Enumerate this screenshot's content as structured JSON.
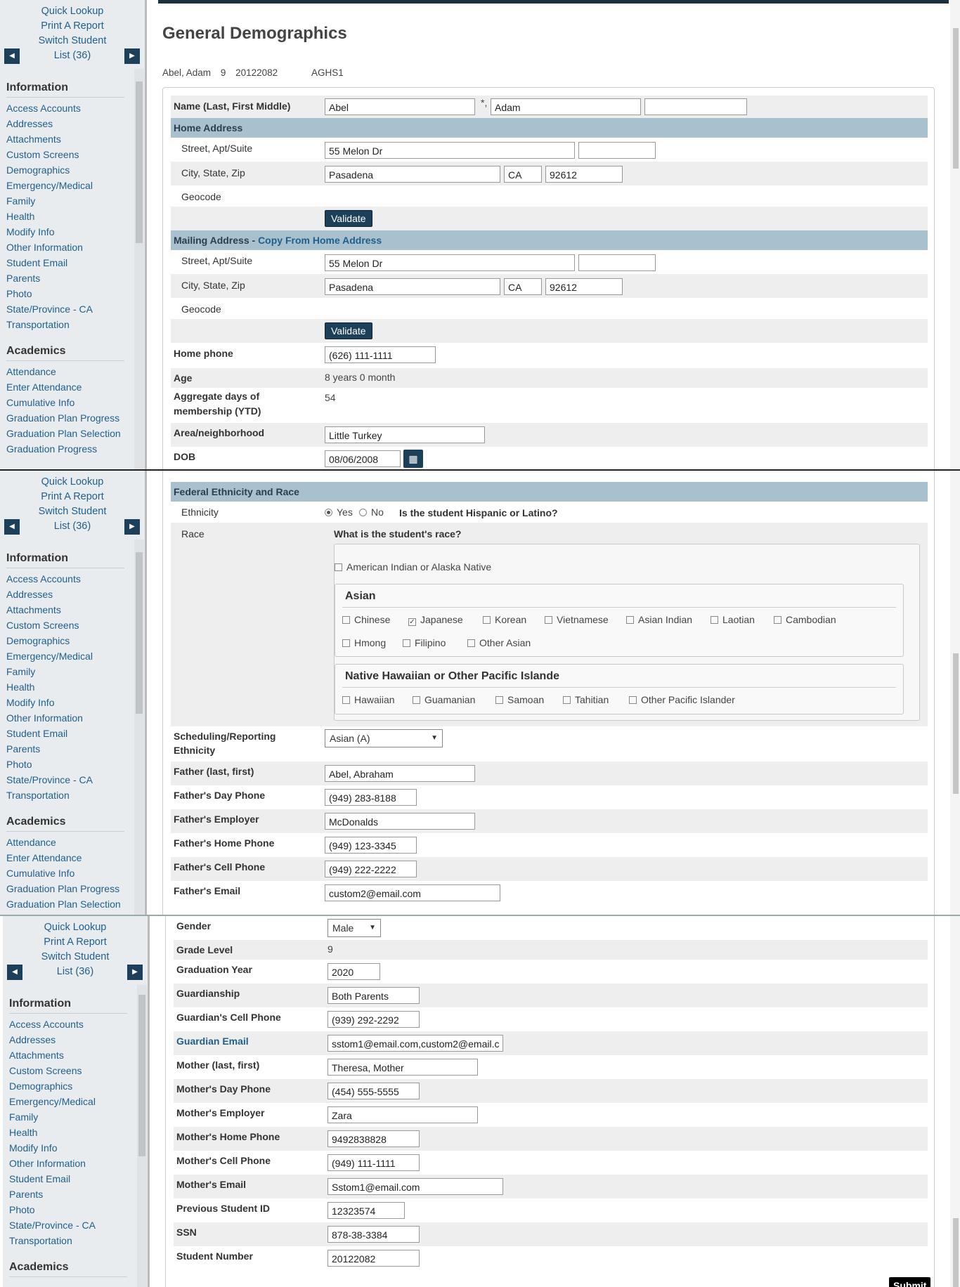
{
  "sidebar": {
    "quick_lookup": "Quick Lookup",
    "print_report": "Print A Report",
    "switch_student": "Switch Student",
    "list_label": "List (36)",
    "info_header": "Information",
    "info_items": [
      "Access Accounts",
      "Addresses",
      "Attachments",
      "Custom Screens",
      "Demographics",
      "Emergency/Medical",
      "Family",
      "Health",
      "Modify Info",
      "Other Information",
      "Student Email",
      "Parents",
      "Photo",
      "State/Province - CA",
      "Transportation"
    ],
    "acad_header": "Academics",
    "acad_items": [
      "Attendance",
      "Enter Attendance",
      "Cumulative Info",
      "Graduation Plan Progress",
      "Graduation Plan Selection",
      "Graduation Progress"
    ]
  },
  "page": {
    "title": "General Demographics",
    "student": {
      "name": "Abel, Adam",
      "grade": "9",
      "id": "20122082",
      "school": "AGHS1"
    }
  },
  "form": {
    "name_label": "Name (Last, First Middle)",
    "last": "Abel",
    "first": "Adam",
    "middle": "",
    "home_address_header": "Home Address",
    "street_label": "Street, Apt/Suite",
    "city_label": "City, State, Zip",
    "geocode_label": "Geocode",
    "home": {
      "street": "55 Melon Dr",
      "apt": "",
      "city": "Pasadena",
      "state": "CA",
      "zip": "92612"
    },
    "validate_label": "Validate",
    "mailing_header": "Mailing Address - ",
    "copy_link": "Copy From Home Address",
    "mail": {
      "street": "55 Melon Dr",
      "apt": "",
      "city": "Pasadena",
      "state": "CA",
      "zip": "92612"
    },
    "home_phone_label": "Home phone",
    "home_phone": "(626) 111-1111",
    "age_label": "Age",
    "age": "8 years 0 month",
    "agg_label_1": "Aggregate days of",
    "agg_label_2": "membership (YTD)",
    "agg_value": "54",
    "area_label": "Area/neighborhood",
    "area": "Little Turkey",
    "dob_label": "DOB",
    "dob": "08/06/2008",
    "federal_header": "Federal Ethnicity and Race",
    "ethnicity_label": "Ethnicity",
    "yes": "Yes",
    "no": "No",
    "hispanic_q": "Is the student Hispanic or Latino?",
    "race_label": "Race",
    "race_q": "What is the student's race?",
    "american_indian": "American Indian or Alaska Native",
    "asian_header": "Asian",
    "asian_options": [
      "Chinese",
      "Japanese",
      "Korean",
      "Vietnamese",
      "Asian Indian",
      "Laotian",
      "Cambodian",
      "Hmong",
      "Filipino",
      "Other Asian"
    ],
    "asian_checked": "Japanese",
    "pacific_header": "Native Hawaiian or Other Pacific Islande",
    "pacific_options": [
      "Hawaiian",
      "Guamanian",
      "Samoan",
      "Tahitian",
      "Other Pacific Islander"
    ],
    "sched_label_1": "Scheduling/Reporting",
    "sched_label_2": "Ethnicity",
    "sched_value": "Asian (A)",
    "father_name_label": "Father (last, first)",
    "father_name": "Abel, Abraham",
    "father_day_label": "Father's Day Phone",
    "father_day": "(949) 283-8188",
    "father_emp_label": "Father's Employer",
    "father_emp": "McDonalds",
    "father_home_label": "Father's Home Phone",
    "father_home": "(949) 123-3345",
    "father_cell_label": "Father's Cell Phone",
    "father_cell": "(949) 222-2222",
    "father_email_label": "Father's Email",
    "father_email": "custom2@email.com",
    "gender_label": "Gender",
    "gender": "Male",
    "grade_label": "Grade Level",
    "grade": "9",
    "grad_year_label": "Graduation Year",
    "grad_year": "2020",
    "guardianship_label": "Guardianship",
    "guardianship": "Both Parents",
    "guardian_cell_label": "Guardian's Cell Phone",
    "guardian_cell": "(939) 292-2292",
    "guardian_email_label": "Guardian Email",
    "guardian_email": "sstom1@email.com,custom2@email.c",
    "mother_name_label": "Mother (last, first)",
    "mother_name": "Theresa, Mother",
    "mother_day_label": "Mother's Day Phone",
    "mother_day": "(454) 555-5555",
    "mother_emp_label": "Mother's Employer",
    "mother_emp": "Zara",
    "mother_home_label": "Mother's Home Phone",
    "mother_home": "9492838828",
    "mother_cell_label": "Mother's Cell Phone",
    "mother_cell": "(949) 111-1111",
    "mother_email_label": "Mother's Email",
    "mother_email": "Sstom1@email.com",
    "prev_id_label": "Previous Student ID",
    "prev_id": "12323574",
    "ssn_label": "SSN",
    "ssn": "878-38-3384",
    "student_number_label": "Student Number",
    "student_number": "20122082",
    "submit_label": "Submit"
  },
  "colors": {
    "accent": "#1c3f5a",
    "section": "#a9c1ce",
    "link": "#1f5f8b"
  }
}
